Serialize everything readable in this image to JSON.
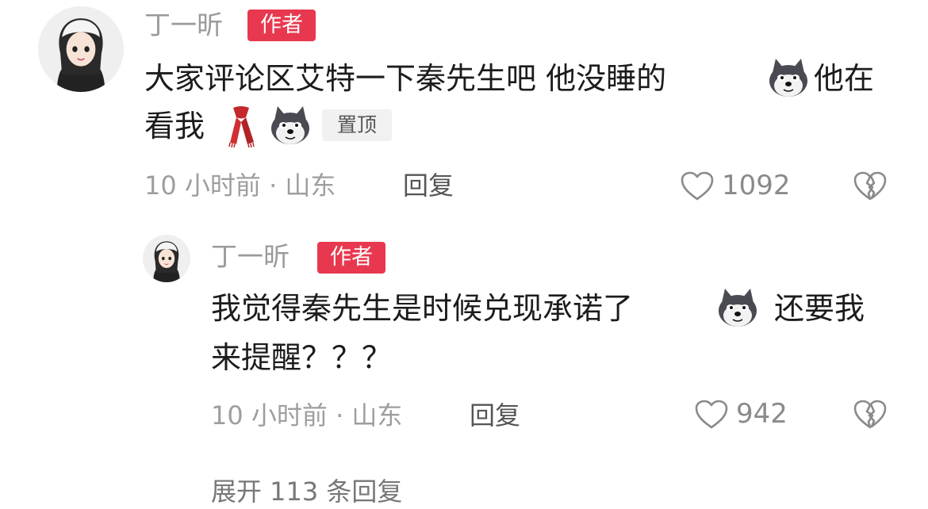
{
  "comment": {
    "author": "丁一昕",
    "badge": "作者",
    "text_line1": "大家评论区艾特一下秦先生吧 他没睡的",
    "text_line1_tail": "他在",
    "text_line2": "看我",
    "pinned_label": "置顶",
    "time_location": "10 小时前 · 山东",
    "reply_label": "回复",
    "like_count": "1092"
  },
  "reply": {
    "author": "丁一昕",
    "badge": "作者",
    "text_line1": "我觉得秦先生是时候兑现承诺了",
    "text_line1_tail": "还要我",
    "text_line2": "来提醒？？？",
    "time_location": "10 小时前 · 山东",
    "reply_label": "回复",
    "like_count": "942"
  },
  "footer": {
    "expand_label": "展开 113 条回复"
  },
  "colors": {
    "badge_bg": "#e8384f",
    "meta_text": "#9e9e9e",
    "body_text": "#1c1c1c"
  },
  "icons": {
    "like": "heart-outline-icon",
    "dislike": "broken-heart-icon",
    "emoji_dog": "husky-dog-emoji",
    "emoji_scarf": "red-scarf-emoji"
  }
}
